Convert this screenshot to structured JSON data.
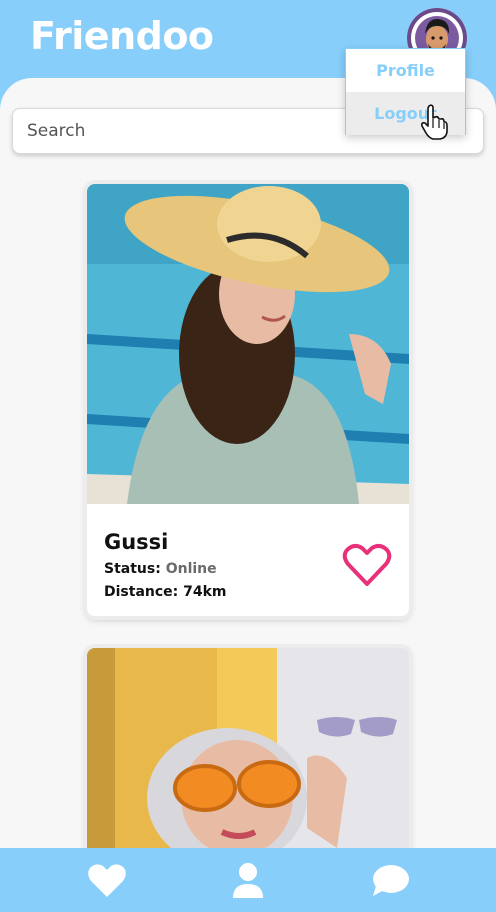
{
  "app": {
    "title": "Friendoo"
  },
  "search": {
    "placeholder": "Search"
  },
  "user_menu": {
    "items": [
      {
        "label": "Profile"
      },
      {
        "label": "Logout"
      }
    ]
  },
  "cards": [
    {
      "name": "Gussi",
      "status_label": "Status:",
      "status_value": "Online",
      "distance_label": "Distance:",
      "distance_value": "74km"
    },
    {}
  ],
  "bottom_nav": {
    "items": [
      {
        "icon": "heart-icon"
      },
      {
        "icon": "user-icon"
      },
      {
        "icon": "chat-icon"
      }
    ]
  },
  "colors": {
    "brand": "#87cefa",
    "heart": "#e8317a",
    "panel": "#f7f7f7",
    "status_value": "#6a6a6a"
  }
}
